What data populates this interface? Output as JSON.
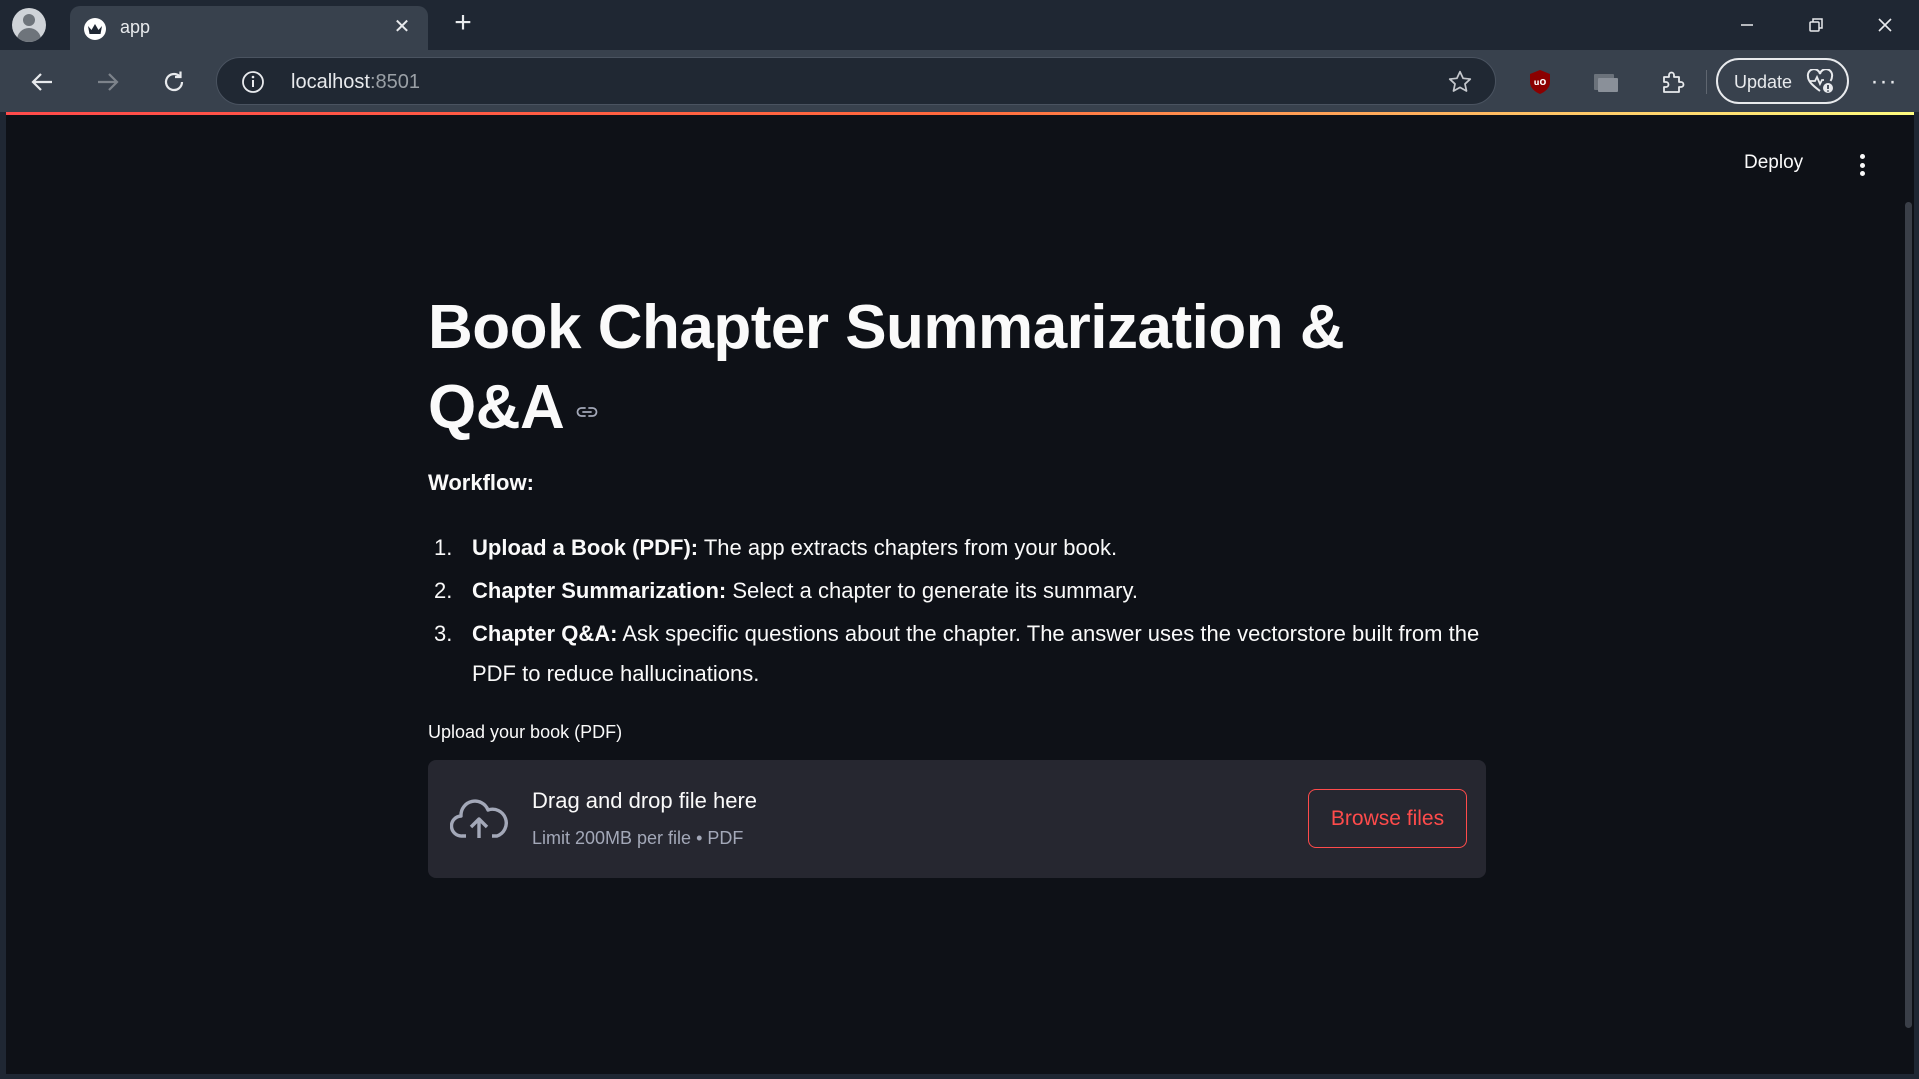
{
  "browser": {
    "tab_title": "app",
    "url_host": "localhost",
    "url_port": ":8501",
    "update_label": "Update"
  },
  "app": {
    "deploy_label": "Deploy",
    "title": "Book Chapter Summarization & Q&A",
    "workflow_heading": "Workflow:",
    "steps": [
      {
        "num": "1.",
        "bold": "Upload a Book (PDF):",
        "text": " The app extracts chapters from your book."
      },
      {
        "num": "2.",
        "bold": "Chapter Summarization:",
        "text": " Select a chapter to generate its summary."
      },
      {
        "num": "3.",
        "bold": "Chapter Q&A:",
        "text": " Ask specific questions about the chapter. The answer uses the vectorstore built from the PDF to reduce hallucinations."
      }
    ],
    "uploader": {
      "label": "Upload your book (PDF)",
      "drop_text": "Drag and drop file here",
      "limit_text": "Limit 200MB per file • PDF",
      "browse_label": "Browse files"
    }
  },
  "colors": {
    "app_bg": "#0e1117",
    "accent": "#ff4b4b",
    "dropzone_bg": "#262730",
    "chrome_bg": "#1f2733",
    "toolbar_bg": "#38414d"
  }
}
